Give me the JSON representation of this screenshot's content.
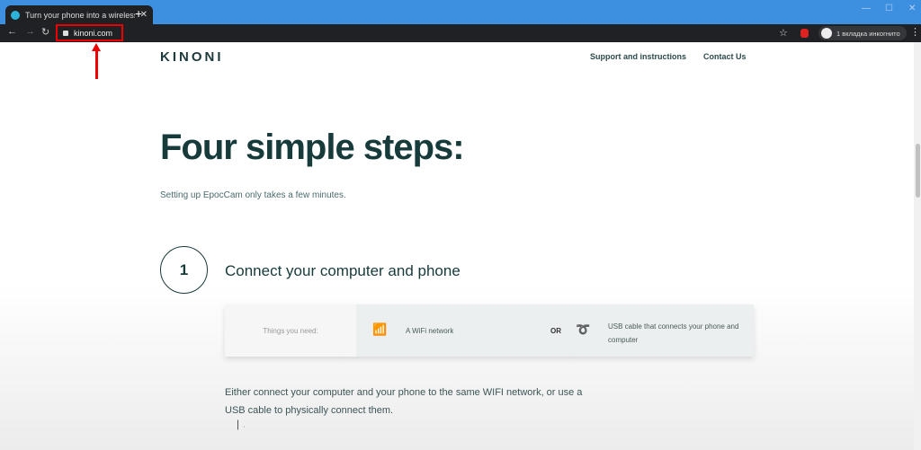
{
  "browser": {
    "tab_title": "Turn your phone into a wireless webcam",
    "url": "kinoni.com",
    "incognito_label": "1 вкладка инкогнито",
    "icons": [
      "back-icon",
      "forward-icon",
      "reload-icon",
      "lock-icon",
      "star-icon",
      "incognito-icon",
      "menu-icon"
    ]
  },
  "header": {
    "logo": "KINONI",
    "links": [
      "Support and instructions",
      "Contact Us"
    ]
  },
  "main": {
    "title": "Four simple steps:",
    "subtitle": "Setting up EpocCam only takes a few minutes.",
    "step": {
      "number": "1",
      "title": "Connect your computer and phone"
    },
    "needs": {
      "label": "Things you need:",
      "wifi": "A WiFi network",
      "or": "OR",
      "usb": "USB cable that connects your phone and computer"
    },
    "description": "Either connect your computer and your phone to the same WIFI network, or use a USB cable to physically connect them."
  },
  "annotation_color": "#e00000"
}
